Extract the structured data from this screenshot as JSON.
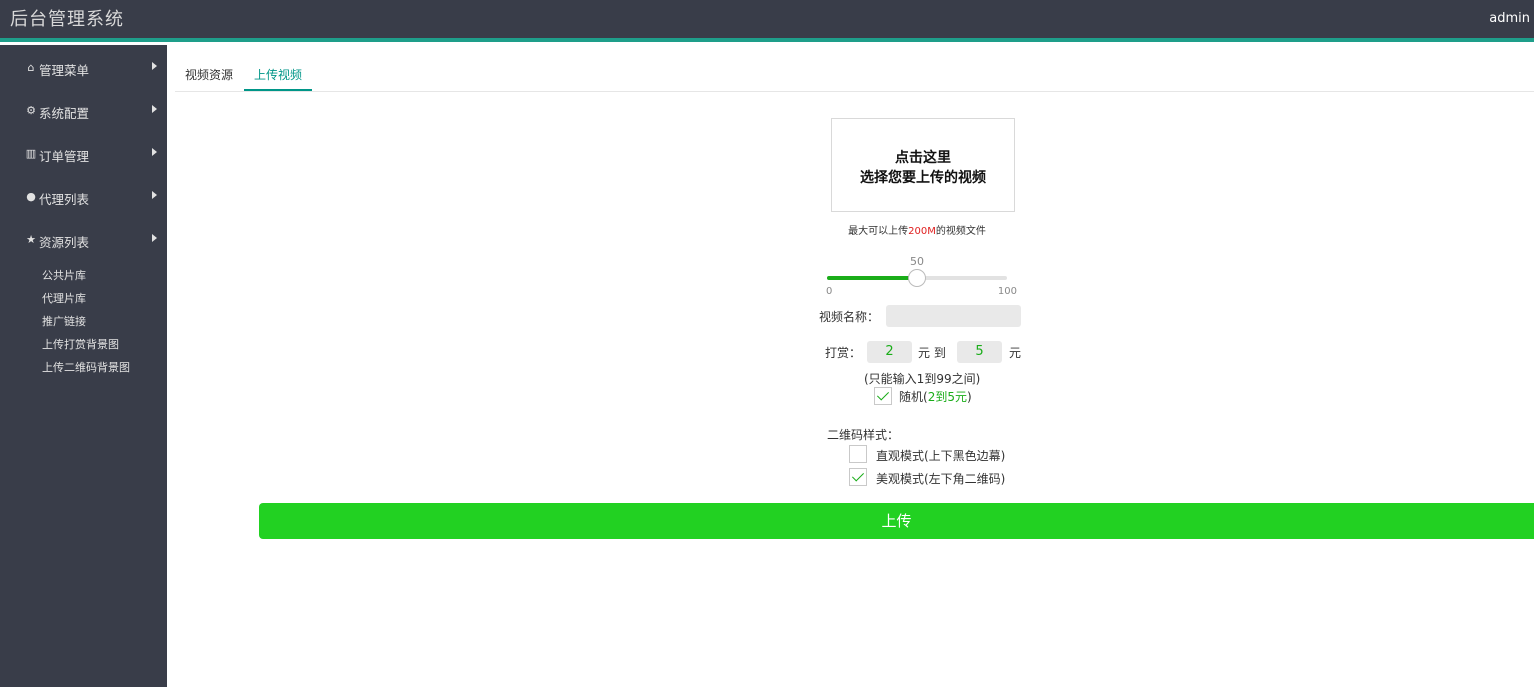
{
  "header": {
    "title": "后台管理系统",
    "user": "admin"
  },
  "sidebar": {
    "items": [
      {
        "icon": "home-icon",
        "glyph": "⌂",
        "label": "管理菜单"
      },
      {
        "icon": "gears-icon",
        "glyph": "⚙",
        "label": "系统配置"
      },
      {
        "icon": "bar-chart-icon",
        "glyph": "▥",
        "label": "订单管理"
      },
      {
        "icon": "user-icon",
        "glyph": "●",
        "label": "代理列表"
      },
      {
        "icon": "star-icon",
        "glyph": "★",
        "label": "资源列表"
      }
    ],
    "sub_items": [
      "公共片库",
      "代理片库",
      "推广链接",
      "上传打赏背景图",
      "上传二维码背景图"
    ]
  },
  "tabs": [
    {
      "label": "视频资源",
      "active": false
    },
    {
      "label": "上传视频",
      "active": true
    }
  ],
  "upload": {
    "line1": "点击这里",
    "line2": "选择您要上传的视频",
    "note_prefix": "最大可以上传",
    "note_size": "200M",
    "note_suffix": "的视频文件"
  },
  "slider": {
    "value": "50",
    "min": "0",
    "max": "100",
    "level": 0.5
  },
  "form": {
    "name_label": "视频名称：",
    "name_value": "",
    "reward_label": "打赏：",
    "reward_min": "2",
    "reward_between": "元 到",
    "reward_max": "5",
    "reward_unit": "元",
    "reward_note": "(只能输入1到99之间)",
    "random_prefix": "随机(",
    "random_range": "2到5元",
    "random_suffix": ")",
    "random_checked": true,
    "qr_label": "二维码样式：",
    "qr_options": [
      {
        "label": "直观模式(上下黑色边幕)",
        "checked": false
      },
      {
        "label": "美观模式(左下角二维码)",
        "checked": true
      }
    ]
  },
  "submit_label": "上传",
  "colors": {
    "header_bg": "#393d49",
    "accent": "#009688",
    "primary_button": "#22d122",
    "highlight": "#e02020"
  }
}
